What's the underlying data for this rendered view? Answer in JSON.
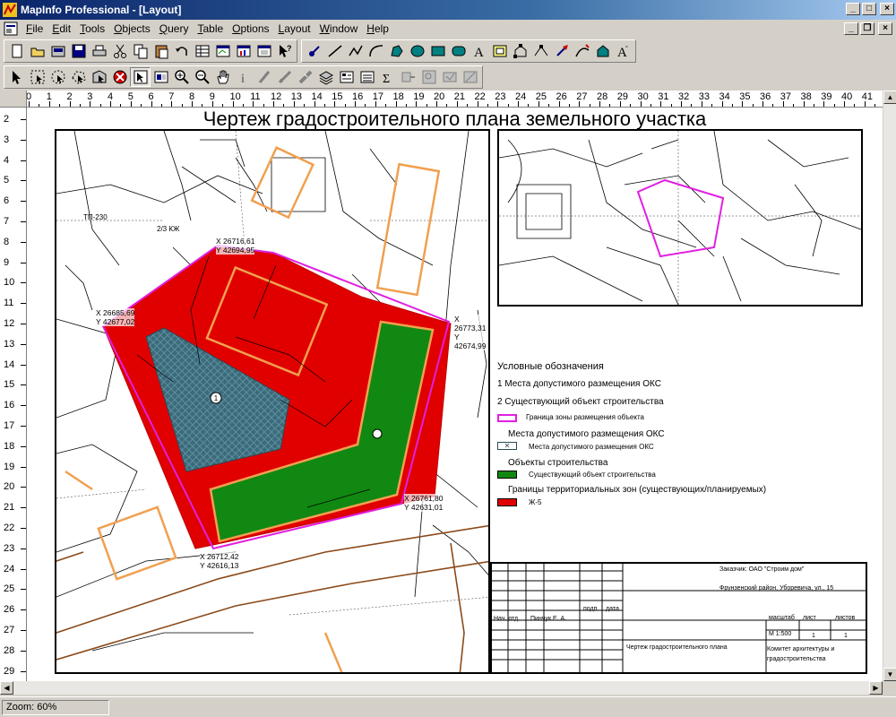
{
  "window": {
    "title": "MapInfo Professional - [Layout]"
  },
  "menu": [
    {
      "key": "file",
      "label": "File"
    },
    {
      "key": "edit",
      "label": "Edit"
    },
    {
      "key": "tools",
      "label": "Tools"
    },
    {
      "key": "objects",
      "label": "Objects"
    },
    {
      "key": "query",
      "label": "Query"
    },
    {
      "key": "table",
      "label": "Table"
    },
    {
      "key": "options",
      "label": "Options"
    },
    {
      "key": "layout",
      "label": "Layout"
    },
    {
      "key": "window",
      "label": "Window"
    },
    {
      "key": "help",
      "label": "Help"
    }
  ],
  "toolbar_standard": [
    "new-icon",
    "open-icon",
    "open-workspace-icon",
    "save-icon",
    "print-icon",
    "cut-icon",
    "copy-icon",
    "paste-icon",
    "undo-icon",
    "new-browser-icon",
    "new-mapper-icon",
    "new-grapher-icon",
    "new-layout-icon",
    "help-pointer-icon"
  ],
  "toolbar_drawing": [
    "symbol-icon",
    "line-icon",
    "polyline-icon",
    "arc-icon",
    "polygon-icon",
    "ellipse-icon",
    "rectangle-icon",
    "rounded-rect-icon",
    "text-icon",
    "frame-icon",
    "reshape-icon",
    "add-node-icon",
    "symbol-style-icon",
    "line-style-icon",
    "region-style-icon",
    "text-style-icon"
  ],
  "toolbar_main": [
    "select-icon",
    "marquee-select-icon",
    "radius-select-icon",
    "polygon-select-icon",
    "boundary-select-icon",
    "unselect-all-icon",
    "graph-select-icon",
    "invert-selection-icon",
    "zoom-in-icon",
    "zoom-out-icon",
    "grabber-icon",
    "info-icon",
    "label-icon",
    "drag-map-icon",
    "ruler-icon",
    "layer-control-icon",
    "show-legend-icon",
    "statistics-icon",
    "sum-icon",
    "hotlink-icon",
    "find-icon",
    "clip-icon",
    "redistrict-icon"
  ],
  "ruler": {
    "h": [
      "0",
      "1",
      "2",
      "3",
      "4",
      "5",
      "6",
      "7",
      "8",
      "9",
      "10",
      "11",
      "12",
      "13",
      "14",
      "15",
      "16",
      "17",
      "18",
      "19",
      "20",
      "21",
      "22",
      "23",
      "24",
      "25",
      "26",
      "27",
      "28",
      "29",
      "30",
      "31",
      "32",
      "33",
      "34",
      "35",
      "36",
      "37",
      "38",
      "39",
      "40",
      "41"
    ],
    "v": [
      "2",
      "3",
      "4",
      "5",
      "6",
      "7",
      "8",
      "9",
      "10",
      "11",
      "12",
      "13",
      "14",
      "15",
      "16",
      "17",
      "18",
      "19",
      "20",
      "21",
      "22",
      "23",
      "24",
      "25",
      "26",
      "27",
      "28",
      "29"
    ]
  },
  "layout": {
    "title": "Чертеж градостроительного плана земельного участка",
    "coords": {
      "c1": [
        "X 26716,61",
        "Y 42694,95"
      ],
      "c2": [
        "X 26685,69",
        "Y 42677,02"
      ],
      "c3": [
        "X 26773,31",
        "Y 42674,99"
      ],
      "c4": [
        "X 26761,80",
        "Y 42631,01"
      ],
      "c5": [
        "X 26712,42",
        "Y 42616,13"
      ]
    },
    "map_labels": {
      "site_number": "1",
      "ext_label_1": "ТП-230",
      "ext_label_2": "2/3 КЖ"
    },
    "legend": {
      "title": "Условные обозначения",
      "item1": "1 Места допустимого размещения ОКС",
      "item2": "2 Существующий объект строительства",
      "boundary_label": "Граница зоны размещения объекта",
      "section_places": "Места допустимого размещения ОКС",
      "places_label": "Места допустимого размещения ОКС",
      "section_objects": "Объекты строительства",
      "existing_label": "Существующий объект строительства",
      "section_zones": "Границы территориальных зон (существующих/планируемых)",
      "zone_label": "Ж-5",
      "colors": {
        "boundary": "#e020e0",
        "zone": "#e00000",
        "existing": "#118811",
        "places": "#40607a"
      }
    },
    "stamp": {
      "customer": "Заказчик: ОАО \"Строим дом\"",
      "address": "Фрунзенский район, Уборевича, ул., 15",
      "head_label": "Нач. отд.",
      "head_name": "Пинчук Е. А.",
      "sign_label": "подп.",
      "date_label": "дата",
      "scale_label": "масштаб",
      "sheet_label": "лист",
      "sheets_label": "листов",
      "scale_value": "М 1:500",
      "sheet_value": "1",
      "sheets_value": "1",
      "drawing_name": "Чертеж градостроительного плана",
      "committee": "Комитет архитектуры и градостроительства"
    }
  },
  "status": {
    "zoom": "Zoom: 60%"
  }
}
